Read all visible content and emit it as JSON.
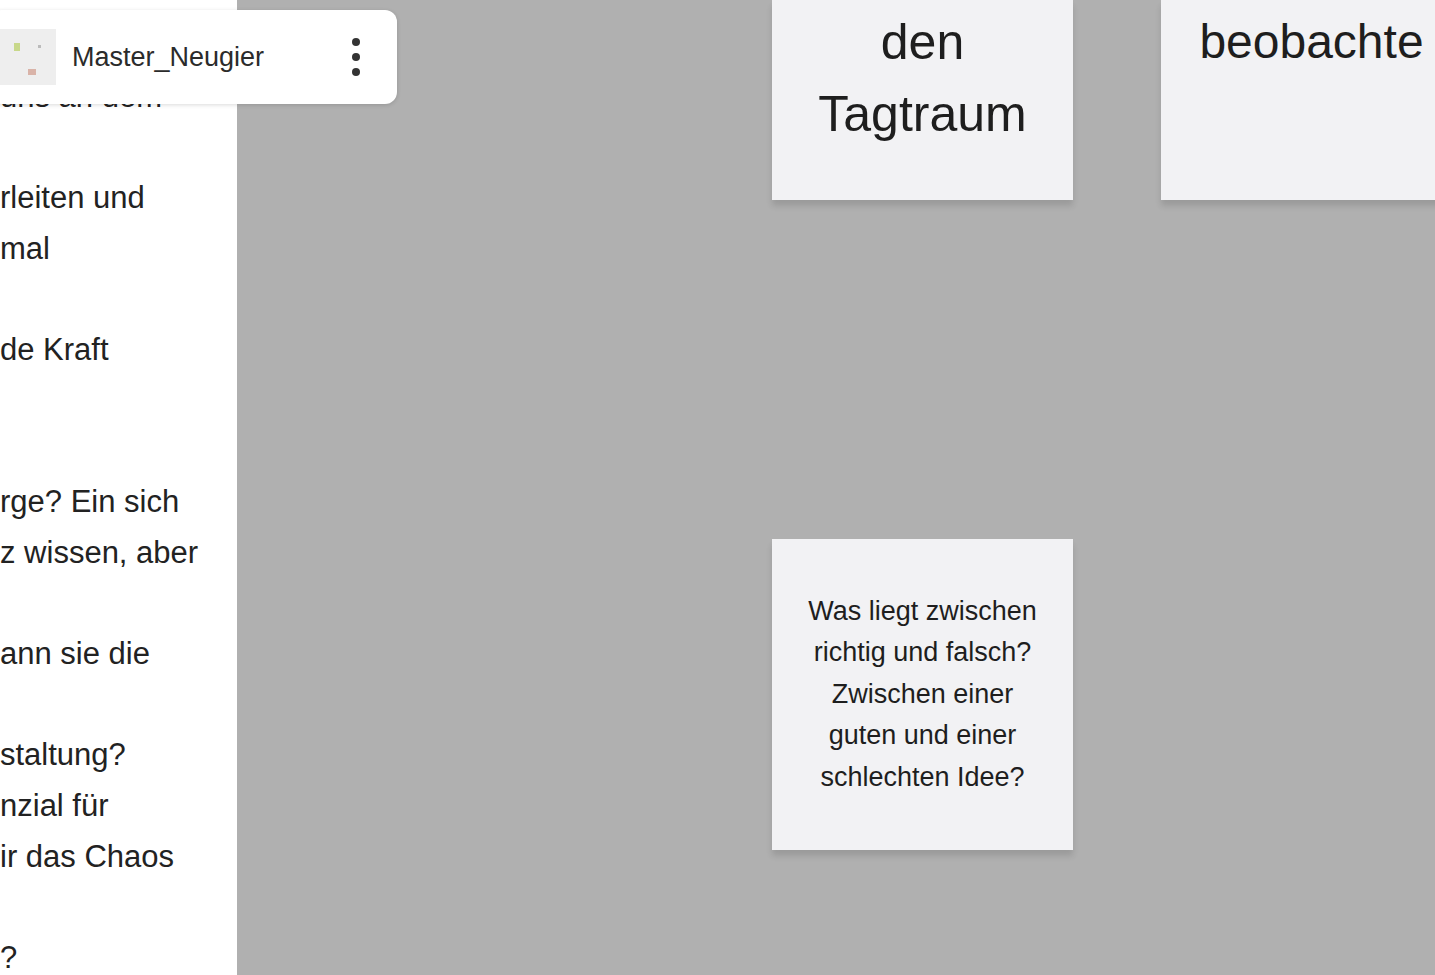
{
  "board": {
    "title": "Master_Neugier"
  },
  "side_text": {
    "paragraphs": [
      [
        "uns an dem"
      ],
      [
        "rleiten und",
        "mal"
      ],
      [
        "de Kraft"
      ],
      [
        "rge? Ein sich",
        "z wissen, aber"
      ],
      [
        "ann sie die"
      ],
      [
        "staltung?",
        "nzial für",
        "ir das Chaos"
      ],
      [
        "?"
      ]
    ]
  },
  "notes": [
    {
      "text": "den Tagtraum"
    },
    {
      "text": "beobachte"
    },
    {
      "text": "Was liegt zwischen richtig und falsch? Zwischen einer guten und einer schlechten Idee?"
    }
  ]
}
